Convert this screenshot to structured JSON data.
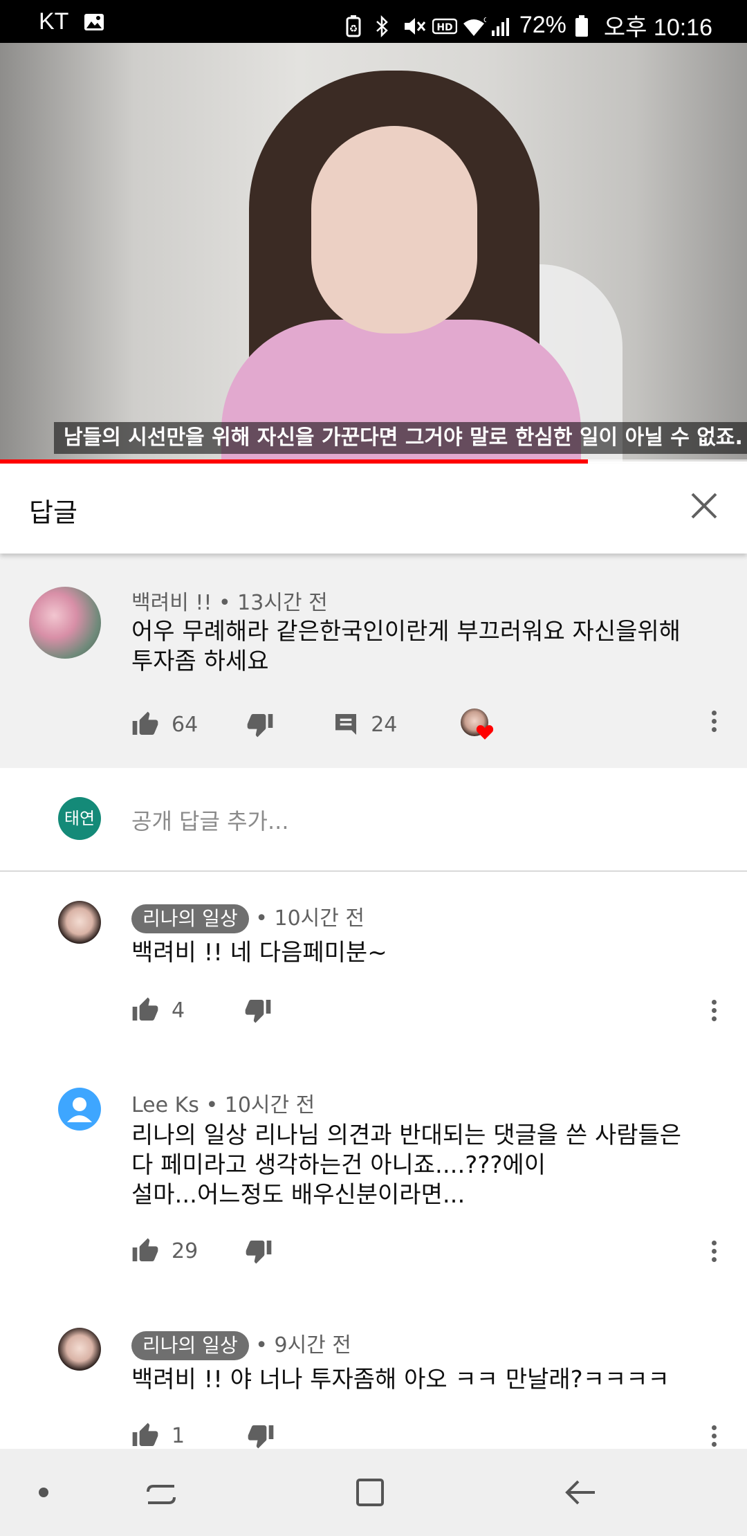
{
  "status_bar": {
    "carrier": "KT",
    "battery": "72%",
    "time": "오후 10:16",
    "icons": [
      "gallery-icon",
      "battery-saver-icon",
      "bluetooth-icon",
      "mute-icon",
      "hd-icon",
      "wifi-icon",
      "signal-icon",
      "battery-icon"
    ]
  },
  "video": {
    "subtitle": "남들의 시선만을 위해 자신을 가꾼다면 그거야 말로 한심한 일이 아닐 수 없죠.",
    "progress": 0.787
  },
  "panel": {
    "title": "답글"
  },
  "parent_comment": {
    "author": "백려비 !!",
    "time": "13시간 전",
    "text_line1": "어우 무례해라 같은한국인이란게 부끄러워요 자신을위해",
    "text_line2": "투자좀 하세요",
    "likes": "64",
    "replies": "24"
  },
  "add_reply": {
    "avatar_text": "태연",
    "placeholder": "공개 답글 추가..."
  },
  "replies": [
    {
      "author": "리나의 일상",
      "author_is_creator": true,
      "time": "10시간 전",
      "lines": [
        "백려비 !! 네 다음페미분~"
      ],
      "likes": "4"
    },
    {
      "author": "Lee Ks",
      "author_is_creator": false,
      "time": "10시간 전",
      "lines": [
        "리나의 일상  리나님 의견과  반대되는 댓글을 쓴 사람들은",
        "다 페미라고 생각하는건 아니죠....???에이",
        "설마...어느정도 배우신분이라면..."
      ],
      "likes": "29"
    },
    {
      "author": "리나의 일상",
      "author_is_creator": true,
      "time": "9시간 전",
      "lines": [
        "백려비 !! 야 너나 투자좀해  아오 ㅋㅋ 만날래?ㅋㅋㅋㅋ"
      ],
      "likes": "1"
    }
  ],
  "colors": {
    "accent_red": "#ff0000",
    "chip_bg": "#6f6f6f",
    "add_reply_avatar": "#148a78",
    "default_avatar": "#3ea6ff"
  }
}
